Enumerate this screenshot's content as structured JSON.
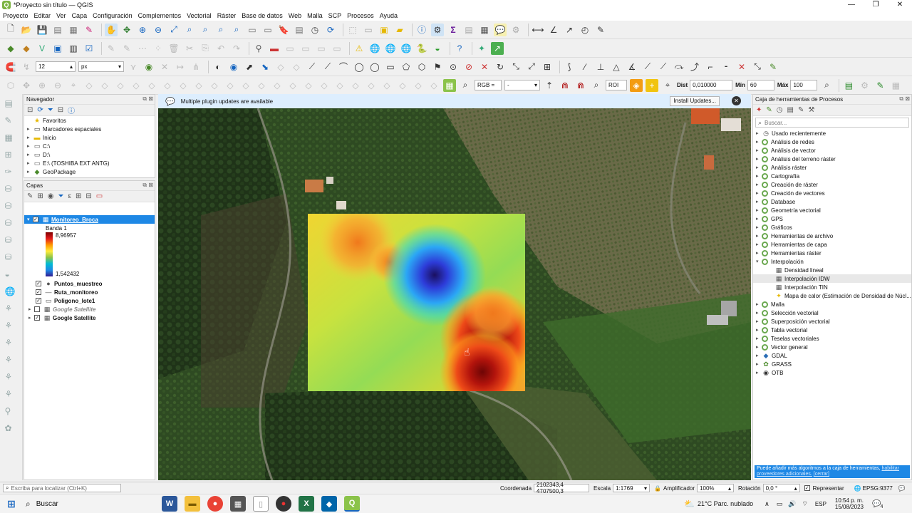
{
  "window": {
    "title": "*Proyecto sin título — QGIS"
  },
  "menu": [
    "Proyecto",
    "Editar",
    "Ver",
    "Capa",
    "Configuración",
    "Complementos",
    "Vectorial",
    "Ráster",
    "Base de datos",
    "Web",
    "Malla",
    "SCP",
    "Procesos",
    "Ayuda"
  ],
  "toolbar": {
    "font_size": "12",
    "font_unit": "px",
    "rgb_label": "RGB =",
    "rgb_value": "-",
    "roi_label": "ROI",
    "dist_label": "Dist",
    "dist_value": "0,010000",
    "min_label": "Mín",
    "min_value": "60",
    "max_label": "Máx",
    "max_value": "100"
  },
  "navigator": {
    "title": "Navegador",
    "items": [
      "Favoritos",
      "Marcadores espaciales",
      "Inicio",
      "C:\\",
      "D:\\",
      "E:\\ (TOSHIBA EXT ANTG)",
      "GeoPackage"
    ]
  },
  "layers": {
    "title": "Capas",
    "active_layer": "Monitoreo_Broca",
    "band_label": "Banda 1",
    "band_max": "8,96957",
    "band_min": "1,542432",
    "items": [
      "Puntos_muestreo",
      "Ruta_monitoreo",
      "Poligono_lote1",
      "Google Satellite",
      "Google Satellite"
    ]
  },
  "messagebar": {
    "text": "Multiple plugin updates are available",
    "install_button": "Install Updates..."
  },
  "processing": {
    "title": "Caja de herramientas de Procesos",
    "search_placeholder": "Buscar...",
    "items": [
      "Usado recientemente",
      "Análisis de redes",
      "Análisis de vector",
      "Análisis del terreno ráster",
      "Análisis ráster",
      "Cartografía",
      "Creación de ráster",
      "Creación de vectores",
      "Database",
      "Geometría vectorial",
      "GPS",
      "Gráficos",
      "Herramientas de archivo",
      "Herramientas de capa",
      "Herramientas ráster",
      "Interpolación"
    ],
    "interp_children": [
      "Densidad lineal",
      "Interpolación IDW",
      "Interpolación TIN",
      "Mapa de calor (Estimación de Densidad de Núcl..."
    ],
    "items_after": [
      "Malla",
      "Selección vectorial",
      "Superposición vectorial",
      "Tabla vectorial",
      "Teselas vectoriales",
      "Vector general",
      "GDAL",
      "GRASS",
      "OTB"
    ],
    "footer_text": "Puede añadir más algoritmos a la caja de herramientas,",
    "footer_link1": "habilitar",
    "footer_link2": "proveedores adicionales.",
    "footer_link3": "[cerrar]"
  },
  "status": {
    "locate_placeholder": "Escriba para localizar (Ctrl+K)",
    "coord_label": "Coordenada",
    "coord_value": "2102343,4 4707500,3",
    "scale_label": "Escala",
    "scale_value": "1:1769",
    "magnifier_label": "Amplificador",
    "magnifier_value": "100%",
    "rotation_label": "Rotación",
    "rotation_value": "0,0 °",
    "render_label": "Representar",
    "crs": "EPSG:9377"
  },
  "taskbar": {
    "search": "Buscar",
    "weather": "21°C  Parc. nublado",
    "lang": "ESP",
    "time": "10:54 p. m.",
    "date": "15/08/2023",
    "notif": "4"
  }
}
